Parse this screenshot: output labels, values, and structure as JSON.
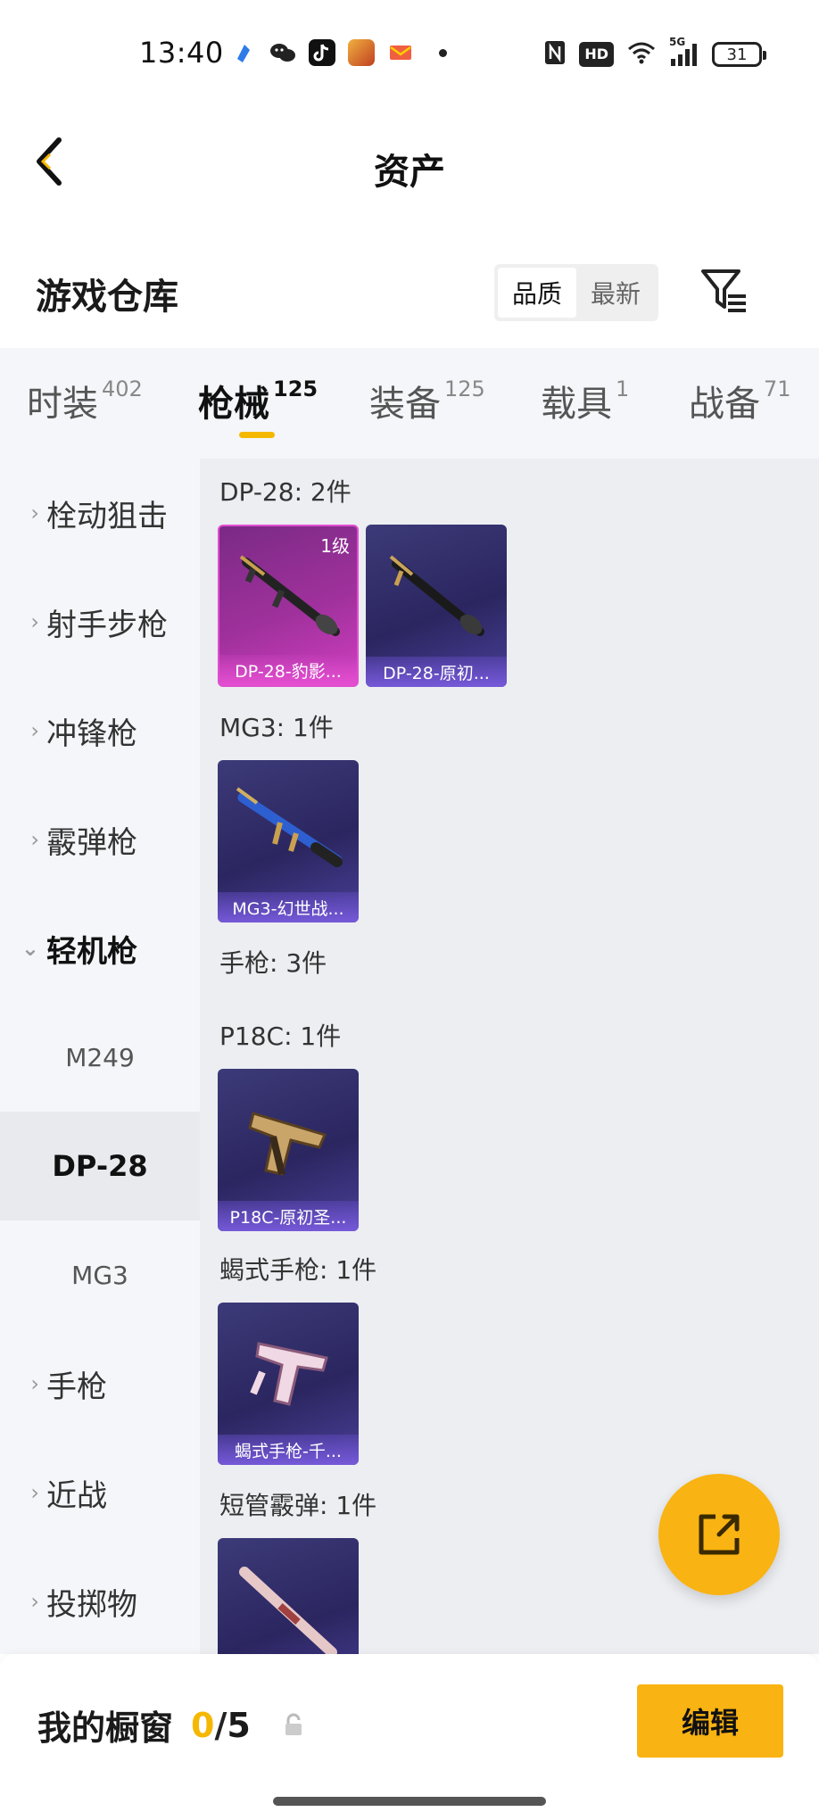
{
  "status_bar": {
    "time": "13:40",
    "battery": "31",
    "signal_label": "5G",
    "hd_label": "HD",
    "icons": [
      "app-icon",
      "wechat-icon",
      "tiktok-icon",
      "game-icon",
      "mail-icon",
      "nfc-icon",
      "hd-icon",
      "wifi-icon",
      "signal-icon",
      "battery-icon"
    ]
  },
  "header": {
    "title": "资产",
    "back_icon": "chevron-left-icon"
  },
  "warehouse": {
    "title": "游戏仓库",
    "sort_options": [
      "品质",
      "最新"
    ],
    "sort_selected": "品质",
    "filter_icon": "filter-icon"
  },
  "tabs": [
    {
      "label": "时装",
      "count": "402"
    },
    {
      "label": "枪械",
      "count": "125",
      "active": true
    },
    {
      "label": "装备",
      "count": "125"
    },
    {
      "label": "载具",
      "count": "1"
    },
    {
      "label": "战备",
      "count": "71"
    }
  ],
  "sidebar": {
    "items": [
      {
        "label": "栓动狙击"
      },
      {
        "label": "射手步枪"
      },
      {
        "label": "冲锋枪"
      },
      {
        "label": "霰弹枪"
      },
      {
        "label": "轻机枪",
        "open": true
      }
    ],
    "subitems": [
      {
        "label": "M249"
      },
      {
        "label": "DP-28",
        "selected": true
      },
      {
        "label": "MG3"
      }
    ],
    "more_items": [
      {
        "label": "手枪"
      },
      {
        "label": "近战"
      },
      {
        "label": "投掷物"
      }
    ]
  },
  "content": {
    "groups": [
      {
        "title": "DP-28: 2件",
        "items": [
          {
            "label": "DP-28-豹影...",
            "level": "1级",
            "rarity": "pink"
          },
          {
            "label": "DP-28-原初...",
            "rarity": "purple"
          }
        ]
      },
      {
        "title": "MG3: 1件",
        "items": [
          {
            "label": "MG3-幻世战...",
            "rarity": "purple"
          }
        ]
      },
      {
        "title": "手枪: 3件",
        "items": []
      },
      {
        "title": "P18C: 1件",
        "items": [
          {
            "label": "P18C-原初圣...",
            "rarity": "purple"
          }
        ]
      },
      {
        "title": "蝎式手枪: 1件",
        "items": [
          {
            "label": "蝎式手枪-千...",
            "rarity": "purple"
          }
        ]
      },
      {
        "title": "短管霰弹: 1件",
        "items": [
          {
            "label": "",
            "rarity": "purple"
          }
        ]
      }
    ]
  },
  "fab": {
    "icon": "share-external-icon"
  },
  "bottom": {
    "showcase_label": "我的橱窗",
    "count_current": "0",
    "count_sep": "/",
    "count_total": "5",
    "lock_icon": "lock-icon",
    "edit_label": "编辑"
  },
  "colors": {
    "accent": "#f9b312",
    "tab_bg": "#f4f6f9",
    "content_bg": "#eceef2"
  }
}
